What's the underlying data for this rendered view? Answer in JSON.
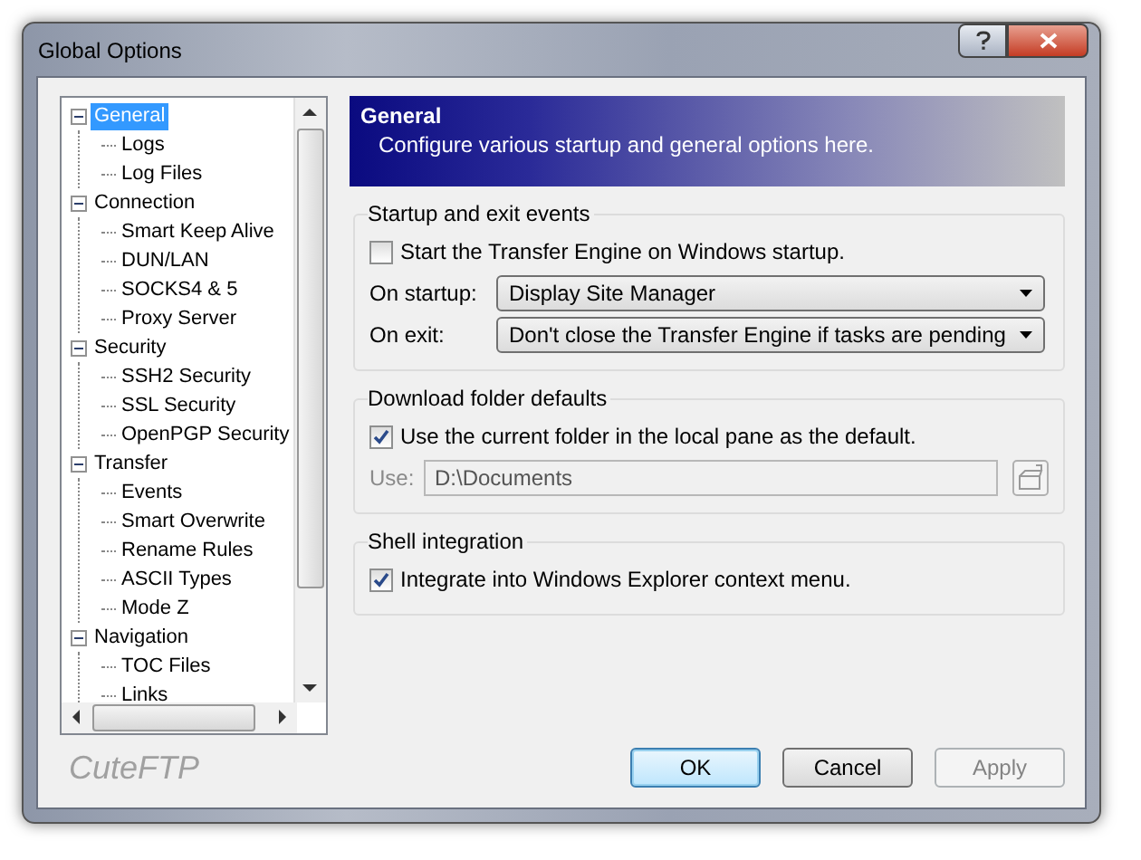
{
  "window": {
    "title": "Global Options"
  },
  "tree": [
    {
      "label": "General",
      "selected": true,
      "expanded": true,
      "children": [
        {
          "label": "Logs",
          "selected": false
        },
        {
          "label": "Log Files",
          "selected": false
        }
      ]
    },
    {
      "label": "Connection",
      "selected": false,
      "expanded": true,
      "children": [
        {
          "label": "Smart Keep Alive",
          "selected": false
        },
        {
          "label": "DUN/LAN",
          "selected": false
        },
        {
          "label": "SOCKS4 & 5",
          "selected": false
        },
        {
          "label": "Proxy Server",
          "selected": false
        }
      ]
    },
    {
      "label": "Security",
      "selected": false,
      "expanded": true,
      "children": [
        {
          "label": "SSH2 Security",
          "selected": false
        },
        {
          "label": "SSL Security",
          "selected": false
        },
        {
          "label": "OpenPGP Security",
          "selected": false
        }
      ]
    },
    {
      "label": "Transfer",
      "selected": false,
      "expanded": true,
      "children": [
        {
          "label": "Events",
          "selected": false
        },
        {
          "label": "Smart Overwrite",
          "selected": false
        },
        {
          "label": "Rename Rules",
          "selected": false
        },
        {
          "label": "ASCII Types",
          "selected": false
        },
        {
          "label": "Mode Z",
          "selected": false
        }
      ]
    },
    {
      "label": "Navigation",
      "selected": false,
      "expanded": true,
      "children": [
        {
          "label": "TOC Files",
          "selected": false
        },
        {
          "label": "Links",
          "selected": false
        }
      ]
    }
  ],
  "header": {
    "title": "General",
    "description": "Configure various startup and general options here."
  },
  "groups": [
    {
      "title": "Startup and exit events",
      "rows": [
        {
          "kind": "checkbox",
          "label": "Start the Transfer Engine on Windows startup.",
          "checked": false
        },
        {
          "kind": "select",
          "label": "On startup:",
          "value": "Display Site Manager"
        },
        {
          "kind": "select",
          "label": "On exit:",
          "value": "Don't close the Transfer Engine if tasks are pending"
        }
      ]
    },
    {
      "title": "Download folder defaults",
      "rows": [
        {
          "kind": "checkbox",
          "label": "Use the current folder in the local pane as the default.",
          "checked": true
        },
        {
          "kind": "path",
          "label": "Use:",
          "value": "D:\\Documents",
          "disabled": true
        }
      ]
    },
    {
      "title": "Shell integration",
      "rows": [
        {
          "kind": "checkbox",
          "label": "Integrate into Windows Explorer context menu.",
          "checked": true
        }
      ]
    }
  ],
  "footer": {
    "brand": "CuteFTP",
    "buttons": [
      {
        "label": "OK",
        "disabled": false,
        "default": true
      },
      {
        "label": "Cancel",
        "disabled": false,
        "default": false
      },
      {
        "label": "Apply",
        "disabled": true,
        "default": false
      }
    ]
  }
}
